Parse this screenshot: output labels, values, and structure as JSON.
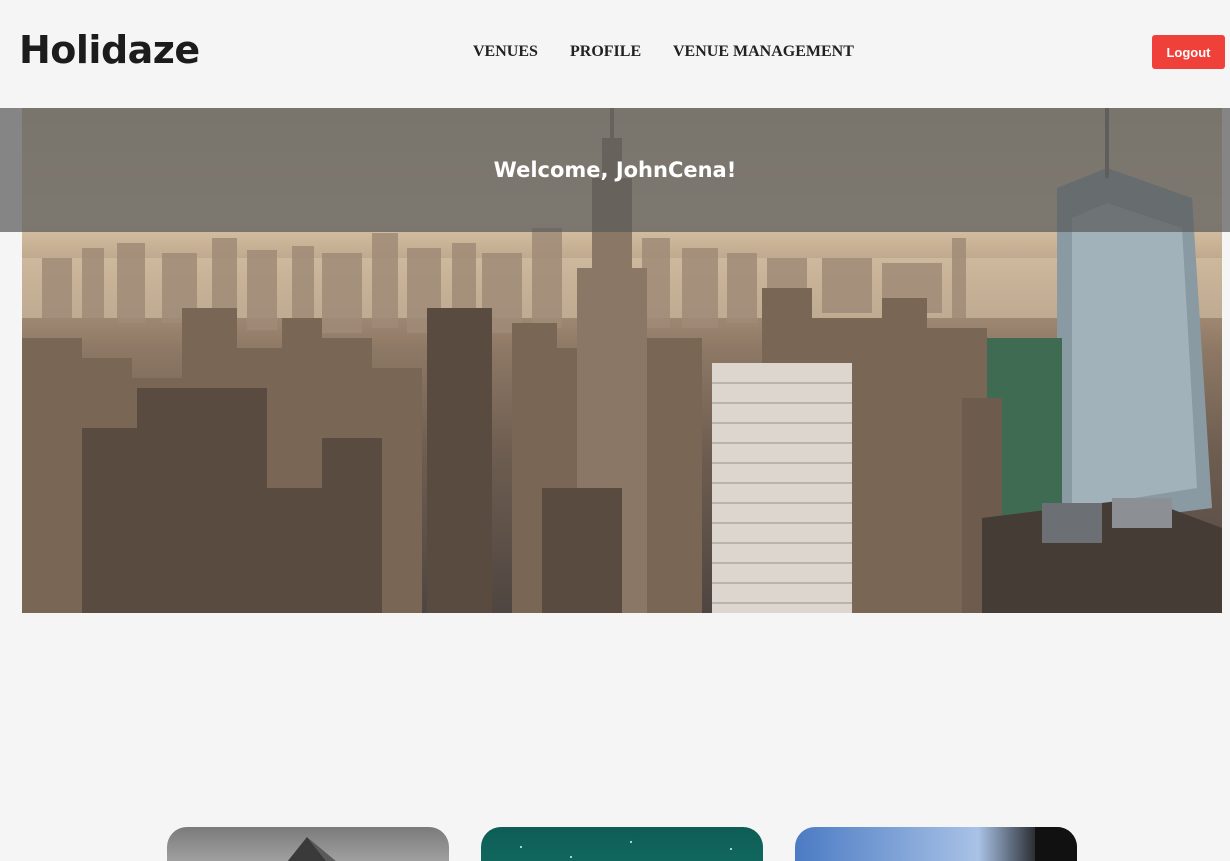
{
  "header": {
    "logo": "Holidaze",
    "nav": [
      {
        "label": "VENUES"
      },
      {
        "label": "PROFILE"
      },
      {
        "label": "VENUE MANAGEMENT"
      }
    ],
    "logout_label": "Logout"
  },
  "hero": {
    "welcome": "Welcome, JohnCena!"
  },
  "colors": {
    "accent": "#f0403a",
    "background": "#f5f5f5"
  }
}
